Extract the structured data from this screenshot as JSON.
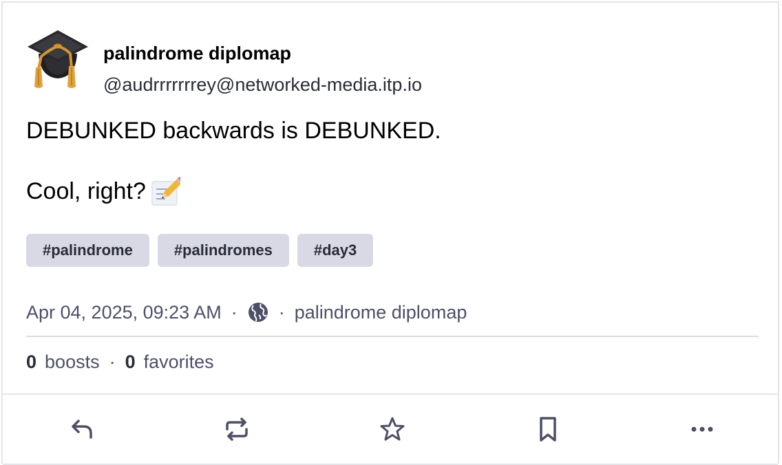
{
  "post": {
    "author": {
      "display_name": "palindrome diplomap",
      "handle": "@audrrrrrrrey@networked-media.itp.io",
      "avatar_icon": "graduation-cap-emoji"
    },
    "content": {
      "line1": "DEBUNKED backwards is DEBUNKED.",
      "line2": "Cool, right?",
      "emoji_icon": "memo-pencil-emoji"
    },
    "tags": [
      "#palindrome",
      "#palindromes",
      "#day3"
    ],
    "meta": {
      "timestamp": "Apr 04, 2025, 09:23 AM",
      "separator": "·",
      "visibility_icon": "globe-icon",
      "application": "palindrome diplomap"
    },
    "stats": {
      "boosts_count": "0",
      "boosts_label": "boosts",
      "favorites_count": "0",
      "favorites_label": "favorites",
      "separator": "·"
    },
    "actions": [
      {
        "name": "reply-button",
        "icon": "reply-icon"
      },
      {
        "name": "boost-button",
        "icon": "repeat-icon"
      },
      {
        "name": "favorite-button",
        "icon": "star-icon"
      },
      {
        "name": "bookmark-button",
        "icon": "bookmark-icon"
      },
      {
        "name": "more-button",
        "icon": "more-dots-icon"
      }
    ]
  },
  "colors": {
    "text_primary": "#000000",
    "text_secondary": "#4d4f67",
    "tag_background": "#d9d9e6",
    "icon_color": "#4d4f67",
    "border": "#e3e3ea"
  }
}
